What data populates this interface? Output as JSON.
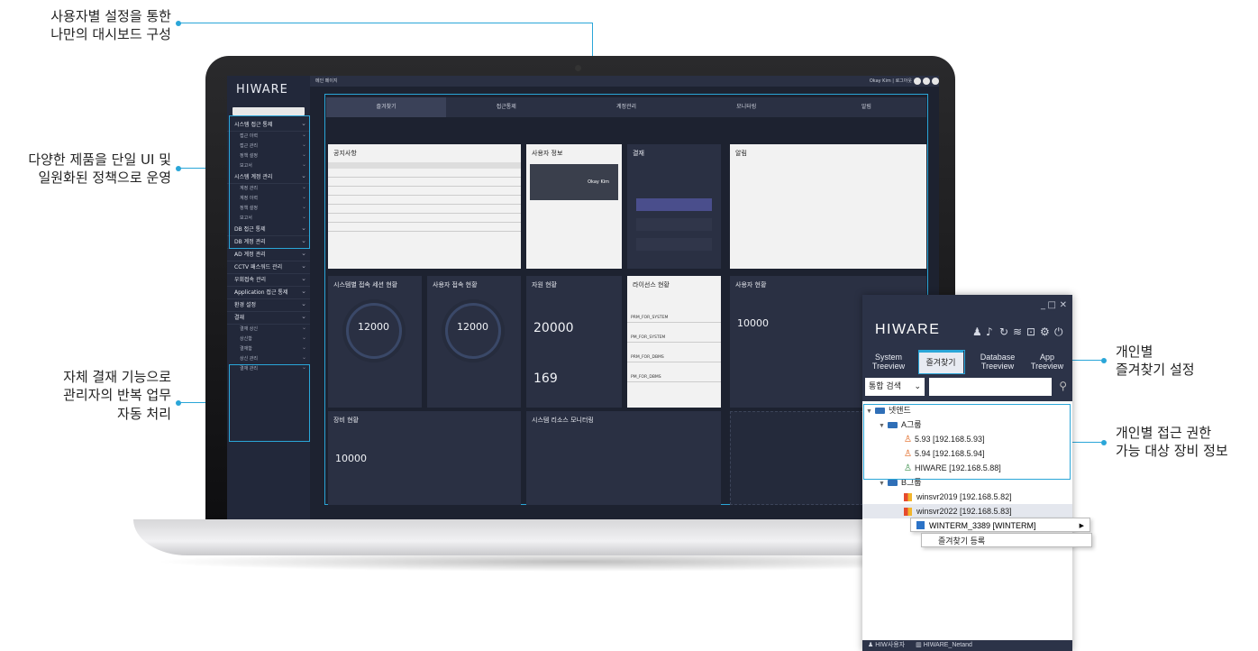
{
  "callouts": {
    "top_line1": "사용자별 설정을 통한",
    "top_line2": "나만의 대시보드 구성",
    "mid_line1": "다양한 제품을 단일 UI 및",
    "mid_line2": "일원화된 정책으로 운영",
    "low_line1": "자체 결재 기능으로",
    "low_line2": "관리자의 반복 업무",
    "low_line3": "자동 처리",
    "right1_line1": "개인별",
    "right1_line2": "즐겨찾기 설정",
    "right2_line1": "개인별 접근 권한",
    "right2_line2": "가능 대상 장비 정보"
  },
  "dashboard": {
    "logo": "HIWARE",
    "topbar_title": "메인 페이지",
    "topbar_user": "Okay Kim | 로그아웃",
    "sidebar": [
      {
        "label": "시스템 접근 통제",
        "subs": [
          "접근 이력",
          "접근 관리",
          "정책 설정",
          "보고서"
        ]
      },
      {
        "label": "시스템 계정 관리",
        "subs": [
          "계정 관리",
          "계정 이력",
          "정책 설정",
          "보고서"
        ]
      },
      {
        "label": "DB 접근 통제",
        "subs": []
      },
      {
        "label": "DB 계정 관리",
        "subs": []
      },
      {
        "label": "AD 계정 관리",
        "subs": []
      },
      {
        "label": "CCTV 패스워드 관리",
        "subs": []
      },
      {
        "label": "우회접속 관리",
        "subs": []
      },
      {
        "label": "Application 접근 통제",
        "subs": []
      },
      {
        "label": "환경 설정",
        "subs": []
      },
      {
        "label": "결재",
        "subs": [
          "결재 상신",
          "상신함",
          "결재함",
          "상신 관리",
          "결재 관리"
        ]
      }
    ],
    "tabs": [
      "즐겨찾기",
      "접근통제",
      "계정관리",
      "모니터링",
      "알림"
    ],
    "panels": {
      "notice": "공지사항",
      "userinfo": "사용자 정보",
      "approval": "결재",
      "alarm": "알림",
      "session": "시스템별 접속 세션 현황",
      "user_access": "사용자 접속 현황",
      "resource": "자원 현황",
      "license": "라이선스 현황",
      "user_status": "사용자 현황",
      "device": "장비 현황",
      "sys_monitor": "시스템 리소스 모니터링"
    },
    "user_name": "Okay Kim",
    "session_num": "12000",
    "user_access_num": "12000",
    "resource_num": "20000",
    "resource_num2": "169",
    "user_status_num": "10000",
    "device_num": "10000",
    "license_rows": [
      "PRM_FOR_SYSTEM",
      "PM_FOR_SYSTEM",
      "PRM_FOR_DBMS",
      "PM_FOR_DBMS"
    ]
  },
  "app": {
    "logo": "HIWARE",
    "tabs": [
      {
        "label": "System\nTreeview"
      },
      {
        "label": "즐겨찾기"
      },
      {
        "label": "Database\nTreeview"
      },
      {
        "label": "App\nTreeview"
      }
    ],
    "search_select": "통합 검색",
    "tree": {
      "root": "넷앤드",
      "groupA": "A그룹",
      "groupA_items": [
        "5.93 [192.168.5.93]",
        "5.94 [192.168.5.94]",
        "HIWARE [192.168.5.88]"
      ],
      "groupB": "B그룹",
      "groupB_items": [
        "winsvr2019 [192.168.5.82]",
        "winsvr2022 [192.168.5.83]"
      ]
    },
    "context_menu": {
      "item1": "WINTERM_3389 [WINTERM]",
      "item2": "즐겨찾기 등록"
    },
    "status_user": "HIW사용자",
    "status_company": "HIWARE_Netand"
  }
}
